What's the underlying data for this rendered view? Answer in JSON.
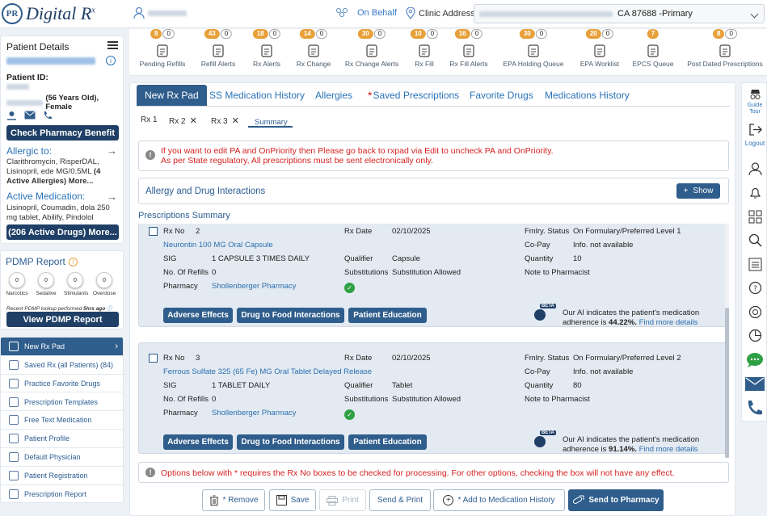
{
  "app": {
    "logo_mark": "PR",
    "logo_name": "Digital R",
    "logo_sup": "x"
  },
  "topbar": {
    "on_behalf": "On Behalf",
    "clinic_label": "Clinic Address",
    "clinic_value": "CA 87688 -Primary"
  },
  "queues": [
    {
      "label": "Pending Refills",
      "count": "8",
      "count2": "0",
      "icon": "hourglass-icon"
    },
    {
      "label": "Refill Alerts",
      "count": "43",
      "count2": "0",
      "icon": "warning-icon"
    },
    {
      "label": "Rx Alerts",
      "count": "18",
      "count2": "0",
      "icon": "rx-alert-icon"
    },
    {
      "label": "Rx Change",
      "count": "14",
      "count2": "0",
      "icon": "swap-arrows-icon"
    },
    {
      "label": "Rx Change Alerts",
      "count": "30",
      "count2": "0",
      "icon": "change-alert-icon"
    },
    {
      "label": "Rx Fill",
      "count": "10",
      "count2": "0",
      "icon": "fill-icon"
    },
    {
      "label": "Rx Fill Alerts",
      "count": "16",
      "count2": "0",
      "icon": "fill-alert-icon"
    },
    {
      "label": "EPA Holding Queue",
      "count": "30",
      "count2": "0",
      "icon": "pause-icon"
    },
    {
      "label": "EPA Worklist",
      "count": "20",
      "count2": "0",
      "icon": "worklist-icon"
    },
    {
      "label": "EPCS Queue",
      "count": "7",
      "count2": "",
      "icon": "epcs-icon"
    },
    {
      "label": "Post Dated Prescriptions",
      "count": "8",
      "count2": "0",
      "icon": "calendar-icon"
    }
  ],
  "patient": {
    "title": "Patient Details",
    "id_label": "Patient ID:",
    "age_sex": "(56 Years Old), Female",
    "check_pharmacy": "Check Pharmacy Benefit",
    "allergic_title": "Allergic to:",
    "allergic_text": "Clarithromycin, RisperDAL, Lisinopril, ede MG/0.5ML",
    "allergic_more": "(4 Active Allergies) More...",
    "active_title": "Active Medication:",
    "active_text": "Lisinopril, Coumadin, dola 250 mg tablet, Abilify, Pindolol",
    "active_btn": "(206 Active Drugs) More..."
  },
  "pdmp": {
    "title": "PDMP Report",
    "items": [
      {
        "value": "0",
        "label": "Narcotics"
      },
      {
        "value": "0",
        "label": "Sedative"
      },
      {
        "value": "0",
        "label": "Stimulants"
      },
      {
        "value": "0",
        "label": "Overdose"
      }
    ],
    "note_a": "Recent PDMP lookup performed",
    "note_b": "5hrs ago",
    "view_btn": "View PDMP Report"
  },
  "nav": [
    {
      "label": "New Rx Pad",
      "icon": "pad-icon",
      "active": true
    },
    {
      "label": "Saved Rx (all Patients) (84)",
      "icon": "saved-icon"
    },
    {
      "label": "Practice Favorite Drugs",
      "icon": "favorite-icon"
    },
    {
      "label": "Prescription Templates",
      "icon": "template-icon"
    },
    {
      "label": "Free Text Medication",
      "icon": "free-text-icon"
    },
    {
      "label": "Patient Profile",
      "icon": "profile-icon"
    },
    {
      "label": "Default Physician",
      "icon": "physician-icon"
    },
    {
      "label": "Patient Registration",
      "icon": "registration-icon"
    },
    {
      "label": "Prescription Report",
      "icon": "report-icon"
    }
  ],
  "tabs": [
    "New Rx Pad",
    "SS Medication History",
    "Allergies",
    "Saved Prescriptions",
    "Favorite Drugs",
    "Medications History"
  ],
  "subtabs": [
    "Rx 1",
    "Rx 2",
    "Rx 3",
    "Summary"
  ],
  "alert_top_1": "If you want to edit PA and OnPriority then Please go back to rxpad via Edit to uncheck PA and OnPriority.",
  "alert_top_2": "As per State regulatory, All prescriptions must be sent electronically only.",
  "allergy_panel": {
    "title": "Allergy and Drug Interactions",
    "show": "Show"
  },
  "summary_title": "Prescriptions Summary",
  "labels": {
    "rx_no": "Rx No",
    "rx_date": "Rx Date",
    "fmlry": "Fmlry. Status",
    "copay": "Co-Pay",
    "sig": "SIG",
    "qualifier": "Qualifier",
    "quantity": "Quantity",
    "refills": "No. Of Refills",
    "subs": "Substitutions",
    "note": "Note to Pharmacist",
    "pharmacy": "Pharmacy",
    "adverse": "Adverse Effects",
    "food": "Drug to Food Interactions",
    "education": "Patient Education",
    "ai_a": "Our AI indicates the patient's medication adherence is",
    "ai_more": "Find more details"
  },
  "prescriptions": [
    {
      "rx_no": "2",
      "drug": "Neurontin 100 MG Oral Capsule",
      "rx_date": "02/10/2025",
      "fmlry": "On Formulary/Preferred Level 1",
      "copay": "Info. not available",
      "sig": "1 CAPSULE 3 TIMES DAILY",
      "qualifier": "Capsule",
      "quantity": "10",
      "refills": "0",
      "subs": "Substitution Allowed",
      "pharmacy": "Shollenberger Pharmacy",
      "adherence": "44.22%."
    },
    {
      "rx_no": "3",
      "drug": "Ferrous Sulfate 325 (65 Fe) MG Oral Tablet Delayed Release",
      "rx_date": "02/10/2025",
      "fmlry": "On Formulary/Preferred Level 2",
      "copay": "Info. not available",
      "sig": "1 TABLET DAILY",
      "qualifier": "Tablet",
      "quantity": "80",
      "refills": "0",
      "subs": "Substitution Allowed",
      "pharmacy": "Shollenberger Pharmacy",
      "adherence": "91.14%."
    }
  ],
  "alert_bottom": "Options below with * requires the Rx No boxes to be checked for processing. For other options, checking the box will not have any effect.",
  "footer": {
    "remove": "* Remove",
    "save": "Save",
    "print": "Print",
    "send_print": "Send & Print",
    "add_history": "* Add to Medication History",
    "send_pharmacy": "Send to Pharmacy"
  },
  "rightbar": {
    "guide": "Guide Tour",
    "logout": "Logout"
  },
  "colors": {
    "navy": "#1f3f66",
    "accent": "#2f5d8c",
    "link": "#2a73b8",
    "alert": "#d62020",
    "badge": "#e8a13a"
  }
}
